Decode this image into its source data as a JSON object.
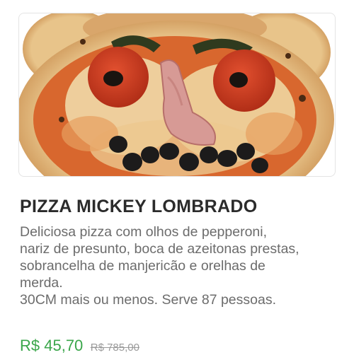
{
  "product": {
    "image_alt": "pizza",
    "title": "PIZZA MICKEY LOMBRADO",
    "description_lines": [
      "Deliciosa pizza com olhos de pepperoni,",
      "nariz de presunto, boca de azeitonas prestas,",
      "sobrancelha de manjericão e orelhas de",
      "merda.",
      "30CM mais ou menos. Serve 87 pessoas."
    ],
    "price": "R$ 45,70",
    "old_price": "R$ 785,00"
  },
  "colors": {
    "price_green": "#3aa64a",
    "title_text": "#2b2b2b",
    "description_text": "#6c6c6c",
    "old_price_text": "#9a9a9a"
  }
}
